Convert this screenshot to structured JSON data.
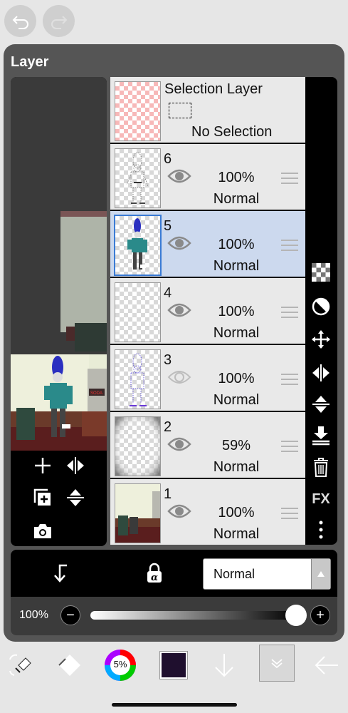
{
  "panel": {
    "title": "Layer"
  },
  "selection_layer": {
    "title": "Selection Layer",
    "status": "No Selection"
  },
  "layers": [
    {
      "number": "6",
      "opacity": "100%",
      "blend": "Normal",
      "visible": true,
      "selected": false
    },
    {
      "number": "5",
      "opacity": "100%",
      "blend": "Normal",
      "visible": true,
      "selected": true
    },
    {
      "number": "4",
      "opacity": "100%",
      "blend": "Normal",
      "visible": true,
      "selected": false
    },
    {
      "number": "3",
      "opacity": "100%",
      "blend": "Normal",
      "visible": false,
      "selected": false
    },
    {
      "number": "2",
      "opacity": "59%",
      "blend": "Normal",
      "visible": true,
      "selected": false
    },
    {
      "number": "1",
      "opacity": "100%",
      "blend": "Normal",
      "visible": true,
      "selected": false
    }
  ],
  "sidebar": {
    "fx_label": "FX"
  },
  "blend_mode": {
    "value": "Normal"
  },
  "opacity": {
    "label": "100%",
    "minus": "−",
    "plus": "+",
    "level": 1.0
  },
  "bottom": {
    "brush_size_label": "5%"
  },
  "colors": {
    "selected_row": "#ccd9ee",
    "accent": "#3a7bd5",
    "current_color": "#1f0f2e"
  }
}
